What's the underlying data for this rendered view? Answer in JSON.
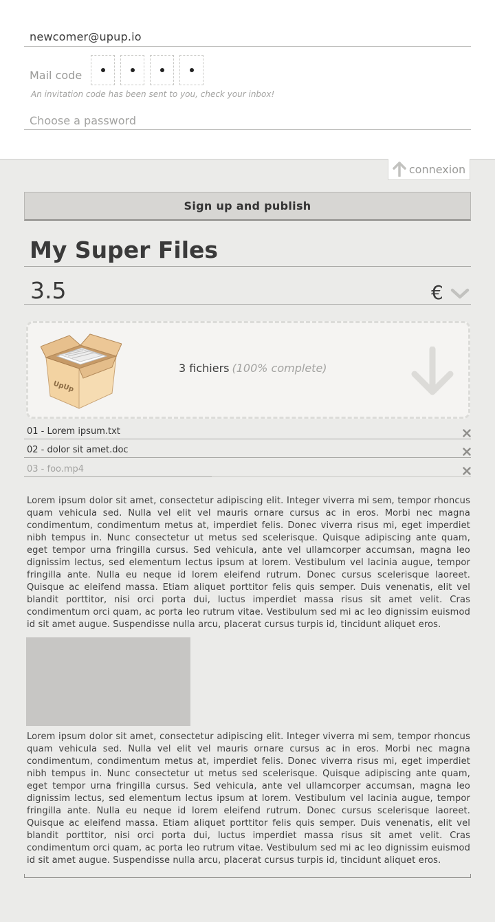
{
  "signup": {
    "email_value": "newcomer@upup.io",
    "mail_code_label": "Mail code",
    "invitation_note": "An invitation code has been sent to you, check your inbox!",
    "password_placeholder": "Choose a password"
  },
  "connexion_label": "connexion",
  "signup_button_label": "Sign up and publish",
  "product": {
    "title": "My Super Files",
    "price": "3.5",
    "currency": "€"
  },
  "dropzone": {
    "files_count_label": "3 fichiers",
    "progress_label": "(100% complete)",
    "box_brand": "UpUp"
  },
  "files": [
    {
      "name": "01 - Lorem ipsum.txt"
    },
    {
      "name": "02 - dolor sit amet.doc"
    },
    {
      "name": "03 - foo.mp4"
    }
  ],
  "description": {
    "paragraph_1": "Lorem ipsum dolor sit amet, consectetur adipiscing elit. Integer viverra mi sem, tempor rhoncus quam vehicula sed. Nulla vel elit vel mauris ornare cursus ac in eros. Morbi nec magna condimentum, condimentum metus at, imperdiet felis. Donec viverra risus mi, eget imperdiet nibh tempus in. Nunc consectetur ut metus sed scelerisque. Quisque adipiscing ante quam, eget tempor urna fringilla cursus. Sed vehicula, ante vel ullamcorper accumsan, magna leo dignissim lectus, sed elementum lectus ipsum at lorem. Vestibulum vel lacinia augue, tempor fringilla ante. Nulla eu neque id lorem eleifend rutrum. Donec cursus scelerisque laoreet. Quisque ac eleifend massa. Etiam aliquet porttitor felis quis semper. Duis venenatis, elit vel blandit porttitor, nisi orci porta dui, luctus imperdiet massa risus sit amet velit. Cras condimentum orci quam, ac porta leo rutrum vitae. Vestibulum sed mi ac leo dignissim euismod id sit amet augue. Suspendisse nulla arcu, placerat cursus turpis id, tincidunt aliquet eros.",
    "paragraph_2": "Lorem ipsum dolor sit amet, consectetur adipiscing elit. Integer viverra mi sem, tempor rhoncus quam vehicula sed. Nulla vel elit vel mauris ornare cursus ac in eros. Morbi nec magna condimentum, condimentum metus at, imperdiet felis. Donec viverra risus mi, eget imperdiet nibh tempus in. Nunc consectetur ut metus sed scelerisque. Quisque adipiscing ante quam, eget tempor urna fringilla cursus. Sed vehicula, ante vel ullamcorper accumsan, magna leo dignissim lectus, sed elementum lectus ipsum at lorem. Vestibulum vel lacinia augue, tempor fringilla ante. Nulla eu neque id lorem eleifend rutrum. Donec cursus scelerisque laoreet. Quisque ac eleifend massa. Etiam aliquet porttitor felis quis semper. Duis venenatis, elit vel blandit porttitor, nisi orci porta dui, luctus imperdiet massa risus sit amet velit. Cras condimentum orci quam, ac porta leo rutrum vitae. Vestibulum sed mi ac leo dignissim euismod id sit amet augue. Suspendisse nulla arcu, placerat cursus turpis id, tincidunt aliquet eros."
  },
  "upload_progress_fraction_file_3": 0.42,
  "icons": {
    "connexion": "arrow-up-icon",
    "currency_dropdown": "chevron-down-icon",
    "dropzone_box": "cardboard-box-icon",
    "download": "arrow-down-icon",
    "remove": "close-icon"
  },
  "colors": {
    "page_background": "#ebebe9",
    "top_panel": "#ffffff",
    "button": "#d7d6d3",
    "dropzone": "#f5f4f2",
    "muted_text": "#a3a3a1"
  }
}
